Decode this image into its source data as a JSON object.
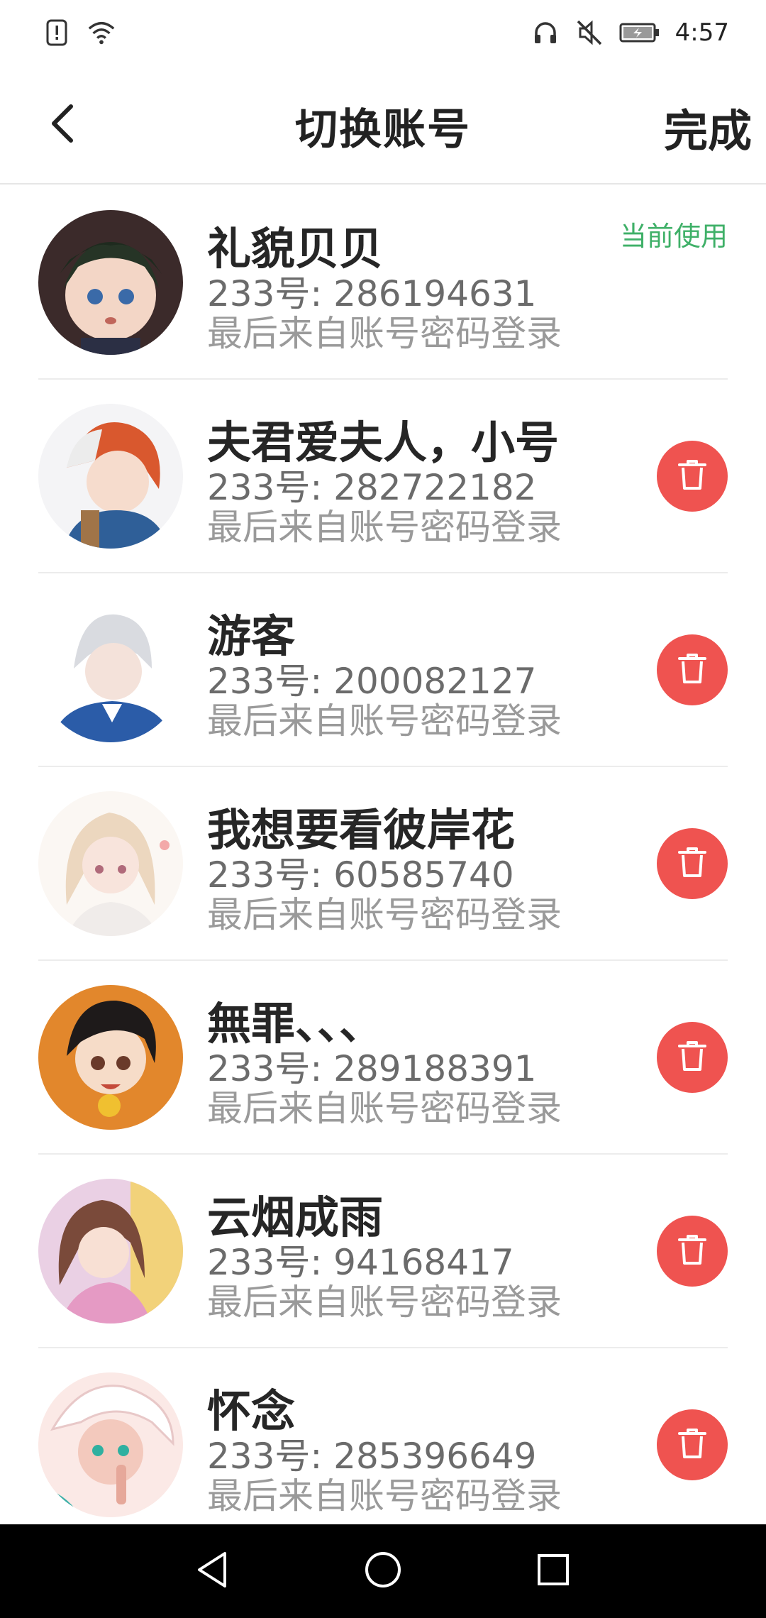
{
  "status_bar": {
    "time": "4:57",
    "left_icons": [
      "alert-icon",
      "wifi-icon"
    ],
    "right_icons": [
      "headphones-icon",
      "mute-icon",
      "battery-icon"
    ]
  },
  "header": {
    "title": "切换账号",
    "done_label": "完成",
    "back_icon": "chevron-left-icon"
  },
  "accounts": [
    {
      "name": "礼貌贝贝",
      "uid": "233号: 286194631",
      "last_login": "最后来自账号密码登录",
      "status": "当前使用",
      "current": true,
      "avatar_color": "#2c3a2e"
    },
    {
      "name": "夫君爱夫人，小号",
      "uid": "233号: 282722182",
      "last_login": "最后来自账号密码登录",
      "current": false,
      "avatar_color": "#d8643a"
    },
    {
      "name": "游客",
      "uid": "233号: 200082127",
      "last_login": "最后来自账号密码登录",
      "current": false,
      "avatar_color": "#c9cfd8"
    },
    {
      "name": "我想要看彼岸花",
      "uid": "233号: 60585740",
      "last_login": "最后来自账号密码登录",
      "current": false,
      "avatar_color": "#f0e2d4"
    },
    {
      "name": "無罪、、、",
      "uid": "233号: 289188391",
      "last_login": "最后来自账号密码登录",
      "current": false,
      "avatar_color": "#e2872c"
    },
    {
      "name": "云烟成雨",
      "uid": "233号: 94168417",
      "last_login": "最后来自账号密码登录",
      "current": false,
      "avatar_color": "#d7a6c6"
    },
    {
      "name": "怀念",
      "uid": "233号: 285396649",
      "last_login": "最后来自账号密码登录",
      "current": false,
      "avatar_color": "#f2c6c0"
    }
  ],
  "colors": {
    "accent_green": "#3fb068",
    "delete_red": "#ef5350",
    "nav_bar": "#000000"
  },
  "nav_bar": {
    "buttons": [
      "back-triangle-icon",
      "home-circle-icon",
      "recents-square-icon"
    ]
  }
}
